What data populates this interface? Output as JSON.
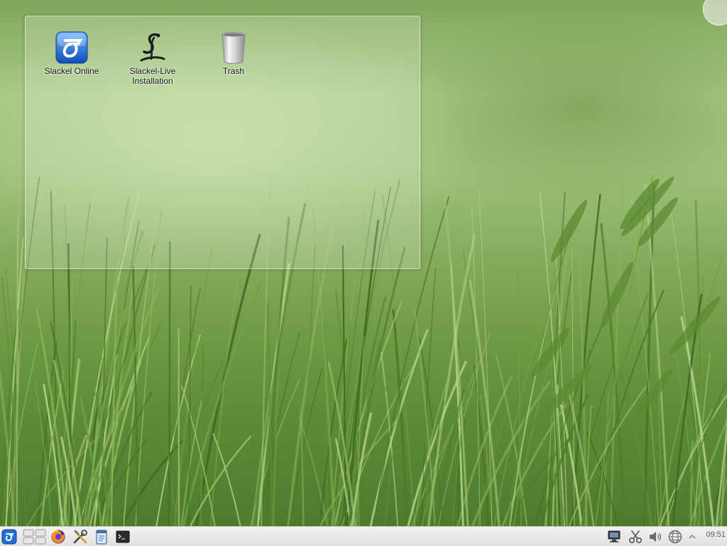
{
  "desktop": {
    "folder_view": {
      "icons": [
        {
          "label": "Slackel Online",
          "icon": "slackel-logo-icon"
        },
        {
          "label": "Slackel-Live\nInstallation",
          "icon": "slackel-installer-icon"
        },
        {
          "label": "Trash",
          "icon": "trash-icon"
        }
      ]
    },
    "toolbox_icon": "plasma-toolbox-icon"
  },
  "panel": {
    "launchers": [
      {
        "name": "application-menu",
        "icon": "slackel-logo-icon"
      },
      {
        "name": "pager",
        "icon": "virtual-desktops-icon"
      },
      {
        "name": "firefox",
        "icon": "firefox-icon"
      },
      {
        "name": "settings",
        "icon": "tools-icon"
      },
      {
        "name": "notes",
        "icon": "notepad-icon"
      },
      {
        "name": "terminal",
        "icon": "terminal-icon"
      }
    ],
    "tray": [
      {
        "name": "network",
        "icon": "network-icon"
      },
      {
        "name": "clipboard",
        "icon": "scissors-icon"
      },
      {
        "name": "volume",
        "icon": "speaker-icon"
      },
      {
        "name": "updates",
        "icon": "globe-icon"
      },
      {
        "name": "expand",
        "icon": "chevron-up-icon"
      }
    ],
    "clock": "09:51"
  },
  "colors": {
    "slackel_blue": "#1f6fd6",
    "panel_bg": "#e8e8e8"
  }
}
